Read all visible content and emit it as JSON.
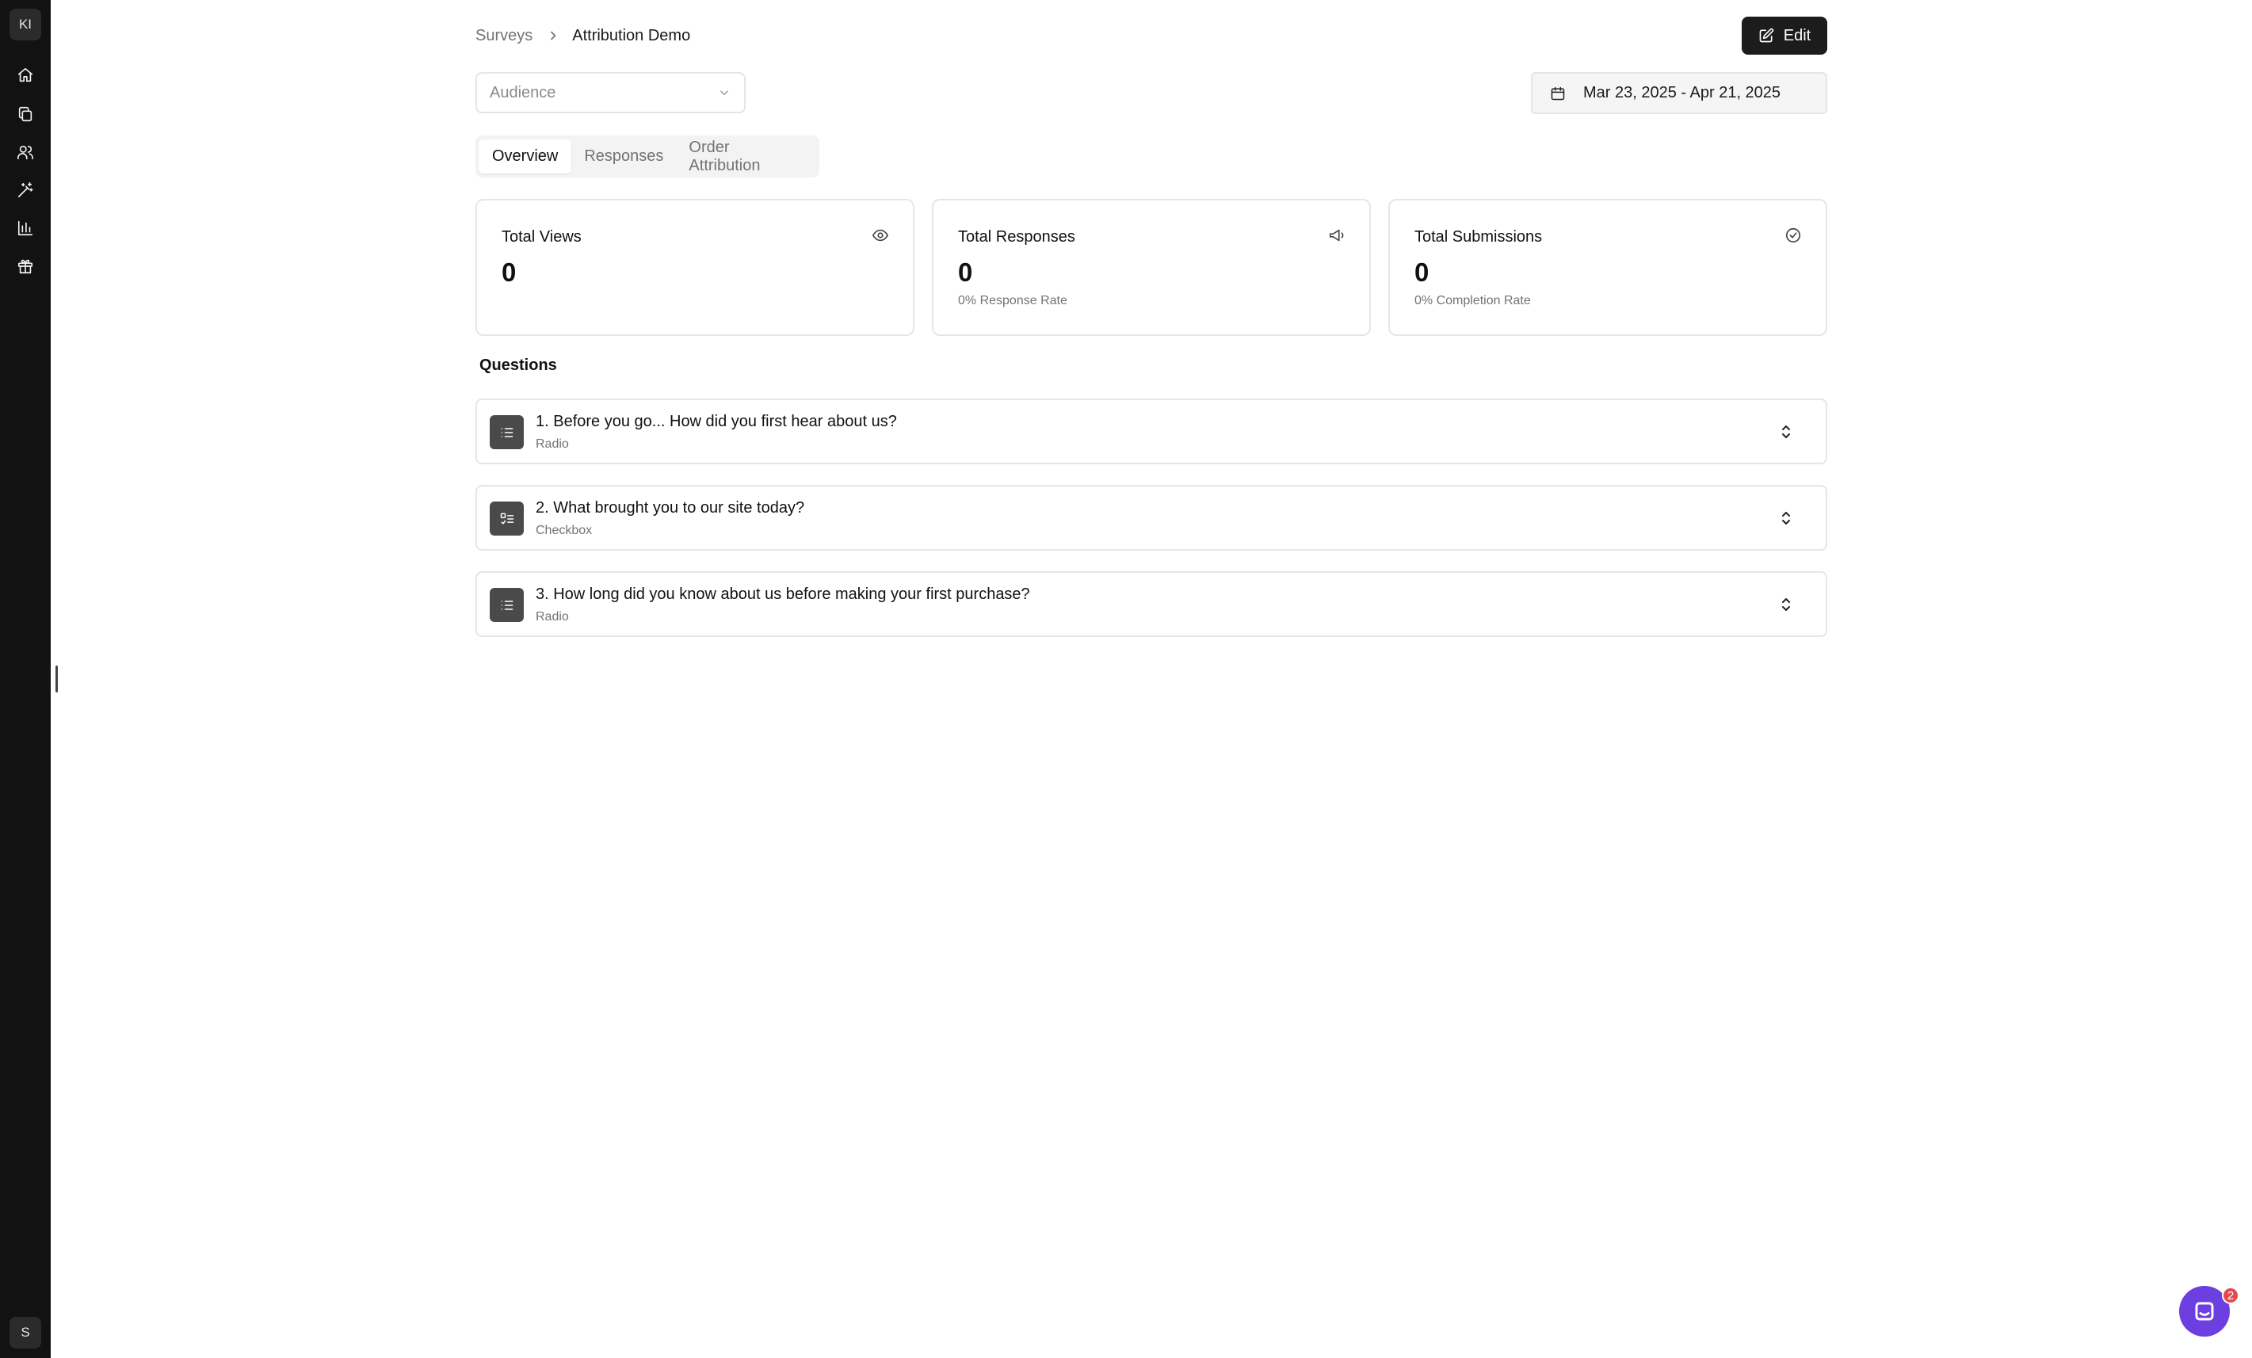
{
  "sidebar": {
    "workspace_initials": "KI",
    "user_initial": "S",
    "items": [
      {
        "icon": "home-icon"
      },
      {
        "icon": "copy-icon"
      },
      {
        "icon": "users-icon"
      },
      {
        "icon": "magic-wand-icon"
      },
      {
        "icon": "bar-chart-icon"
      },
      {
        "icon": "gift-icon"
      }
    ]
  },
  "breadcrumb": {
    "parent": "Surveys",
    "current": "Attribution Demo"
  },
  "header": {
    "edit_label": "Edit"
  },
  "filters": {
    "audience_placeholder": "Audience",
    "date_range": "Mar 23, 2025 - Apr 21, 2025"
  },
  "tabs": [
    {
      "label": "Overview",
      "active": true
    },
    {
      "label": "Responses",
      "active": false
    },
    {
      "label": "Order Attribution",
      "active": false
    }
  ],
  "stats": [
    {
      "title": "Total Views",
      "value": "0",
      "sub": "",
      "icon": "eye-icon"
    },
    {
      "title": "Total Responses",
      "value": "0",
      "sub": "0% Response Rate",
      "icon": "megaphone-icon"
    },
    {
      "title": "Total Submissions",
      "value": "0",
      "sub": "0% Completion Rate",
      "icon": "check-circle-icon"
    }
  ],
  "questions": {
    "heading": "Questions",
    "items": [
      {
        "title": "1. Before you go... How did you first hear about us?",
        "type": "Radio",
        "icon": "list-icon"
      },
      {
        "title": "2. What brought you to our site today?",
        "type": "Checkbox",
        "icon": "checklist-icon"
      },
      {
        "title": "3. How long did you know about us before making your first purchase?",
        "type": "Radio",
        "icon": "list-icon"
      }
    ]
  },
  "chat": {
    "unread_count": "2"
  },
  "colors": {
    "sidebar_bg": "#121212",
    "primary_button": "#1c1c1c",
    "chat_accent": "#6d3fe0",
    "badge_red": "#e5484d"
  }
}
